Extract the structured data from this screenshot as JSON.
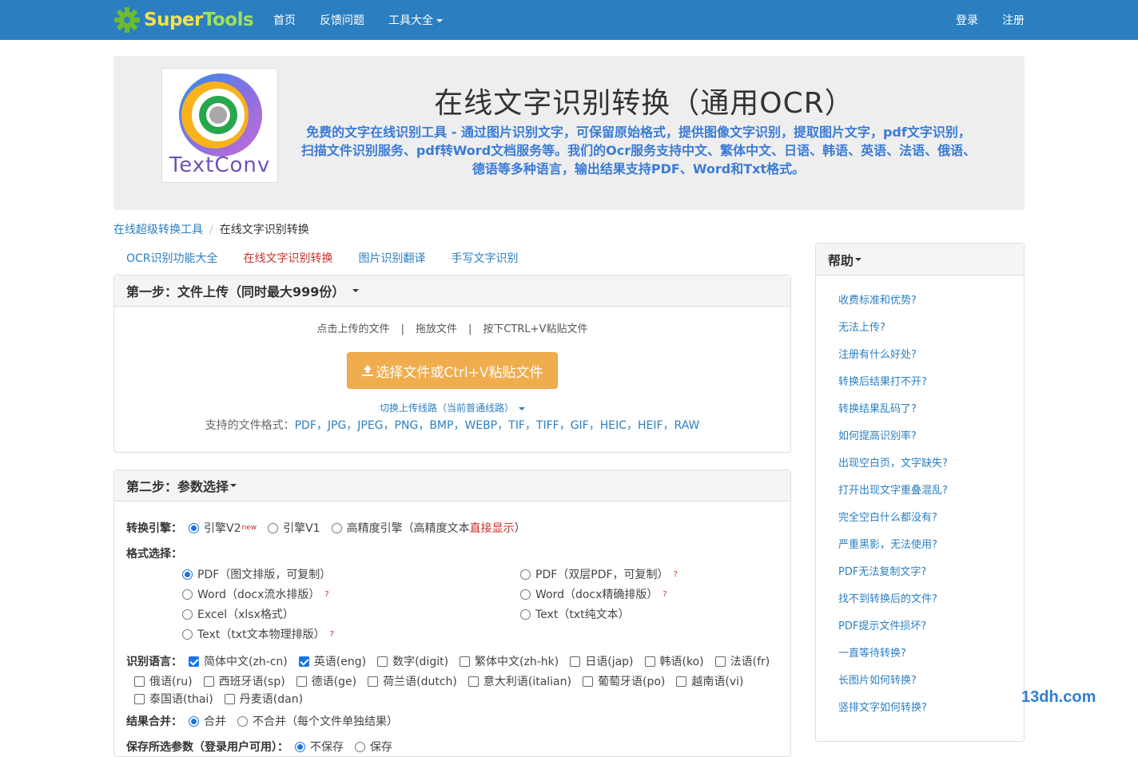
{
  "nav": {
    "brand_word1": "Super",
    "brand_word2": "Tools",
    "links": [
      "首页",
      "反馈问题",
      "工具大全"
    ],
    "login": "登录",
    "register": "注册"
  },
  "hero": {
    "logo_text": "TextConv",
    "title": "在线文字识别转换（通用OCR）",
    "description": "免费的文字在线识别工具 - 通过图片识别文字，可保留原始格式，提供图像文字识别，提取图片文字，pdf文字识别，扫描文件识别服务、pdf转Word文档服务等。我们的Ocr服务支持中文、繁体中文、日语、韩语、英语、法语、俄语、德语等多种语言，输出结果支持PDF、Word和Txt格式。"
  },
  "breadcrumb": {
    "home": "在线超级转换工具",
    "current": "在线文字识别转换"
  },
  "tabs": [
    "OCR识别功能大全",
    "在线文字识别转换",
    "图片识别翻译",
    "手写文字识别"
  ],
  "step1": {
    "title": "第一步：文件上传（同时最大999份）",
    "hints": [
      "点击上传的文件",
      "拖放文件",
      "按下CTRL+V粘贴文件"
    ],
    "separator": "|",
    "upload_button": "选择文件或Ctrl+V粘贴文件",
    "line_switch": "切换上传线路（当前普通线路）",
    "formats_label": "支持的文件格式：",
    "formats": "PDF，JPG，JPEG，PNG，BMP，WEBP，TIF，TIFF，GIF，HEIC，HEIF，RAW"
  },
  "step2": {
    "title": "第二步：参数选择",
    "engine_label": "转换引擎：",
    "engine_v2": "引擎V2",
    "engine_v2_badge": "new",
    "engine_v1": "引擎V1",
    "engine_hp_prefix": "高精度引擎（高精度文本",
    "engine_hp_highlight": "直接显示",
    "engine_hp_suffix": "）",
    "format_label": "格式选择：",
    "formats_left": [
      "PDF（图文排版，可复制）",
      "Word（docx流水排版）",
      "Excel（xlsx格式）",
      "Text（txt文本物理排版）"
    ],
    "formats_right": [
      "PDF（双层PDF，可复制）",
      "Word（docx精确排版）",
      "Text（txt纯文本）"
    ],
    "qmark": "?",
    "lang_label": "识别语言：",
    "langs_row1": [
      "简体中文(zh-cn)",
      "英语(eng)",
      "数字(digit)",
      "繁体中文(zh-hk)",
      "日语(jap)",
      "韩语(ko)",
      "法语(fr)"
    ],
    "langs_row2": [
      "俄语(ru)",
      "西班牙语(sp)",
      "德语(ge)",
      "荷兰语(dutch)",
      "意大利语(italian)",
      "葡萄牙语(po)",
      "越南语(vi)"
    ],
    "langs_row3": [
      "泰国语(thai)",
      "丹麦语(dan)"
    ],
    "merge_label": "结果合并：",
    "merge_yes": "合并",
    "merge_no": "不合并（每个文件单独结果）",
    "keep_label": "保存所选参数（登录用户可用）：",
    "keep_no": "不保存",
    "keep_yes": "保存"
  },
  "help": {
    "title": "帮助",
    "items": [
      "收费标准和优势?",
      "无法上传?",
      "注册有什么好处?",
      "转换后结果打不开?",
      "转换结果乱码了?",
      "如何提高识别率?",
      "出现空白页，文字缺失?",
      "打开出现文字重叠混乱?",
      "完全空白什么都没有?",
      "严重黑影，无法使用?",
      "PDF无法复制文字?",
      "找不到转换后的文件?",
      "PDF提示文件损坏?",
      "一直等待转换?",
      "长图片如何转换?",
      "竖排文字如何转换?"
    ]
  },
  "watermark": "13dh.com",
  "colors": {
    "navbar": "#2b7fc1",
    "link": "#2b7fc1",
    "upload_button": "#f0ad4e",
    "active_tab": "#c9302c"
  }
}
